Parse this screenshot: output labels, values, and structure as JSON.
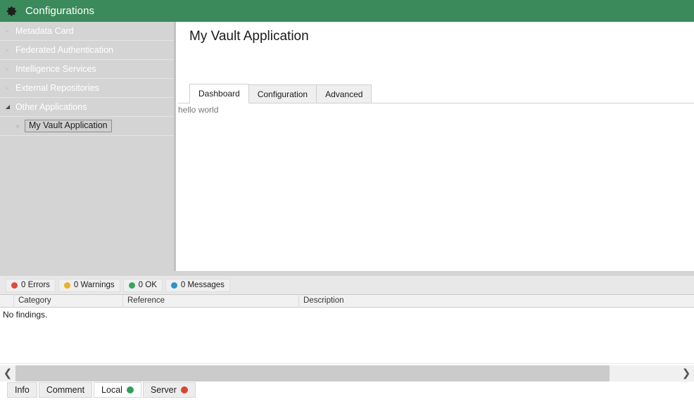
{
  "header": {
    "icon": "gear-icon",
    "title": "Configurations",
    "background_color": "#3b8a5c"
  },
  "sidebar": {
    "items": [
      {
        "label": "Metadata Card",
        "expanded": false,
        "marker": "▸"
      },
      {
        "label": "Federated Authentication",
        "expanded": false,
        "marker": "▸"
      },
      {
        "label": "Intelligence Services",
        "expanded": false,
        "marker": "▸"
      },
      {
        "label": "External Repositories",
        "expanded": false,
        "marker": "▸"
      },
      {
        "label": "Other Applications",
        "expanded": true,
        "marker": "◢"
      }
    ],
    "children": [
      {
        "label": "My Vault Application",
        "marker": "▹",
        "selected": true
      }
    ]
  },
  "main": {
    "title": "My Vault Application",
    "tabs": [
      {
        "label": "Dashboard",
        "active": true
      },
      {
        "label": "Configuration",
        "active": false
      },
      {
        "label": "Advanced",
        "active": false
      }
    ],
    "panel_text": "hello world"
  },
  "findings": {
    "severity_filters": [
      {
        "label": "0 Errors",
        "color": "#e04a3a"
      },
      {
        "label": "0 Warnings",
        "color": "#e8b41f"
      },
      {
        "label": "0 OK",
        "color": "#3aa45f"
      },
      {
        "label": "0 Messages",
        "color": "#2d93c8"
      }
    ],
    "columns": [
      "",
      "Category",
      "Reference",
      "Description"
    ],
    "rows": [],
    "empty_message": "No findings."
  },
  "scrollbar": {
    "left_arrow": "❮",
    "right_arrow": "❯"
  },
  "bottom_tabs": [
    {
      "label": "Info",
      "active": false,
      "dot": null
    },
    {
      "label": "Comment",
      "active": false,
      "dot": null
    },
    {
      "label": "Local",
      "active": true,
      "dot": "#29a35a"
    },
    {
      "label": "Server",
      "active": false,
      "dot": "#d9462f"
    }
  ]
}
